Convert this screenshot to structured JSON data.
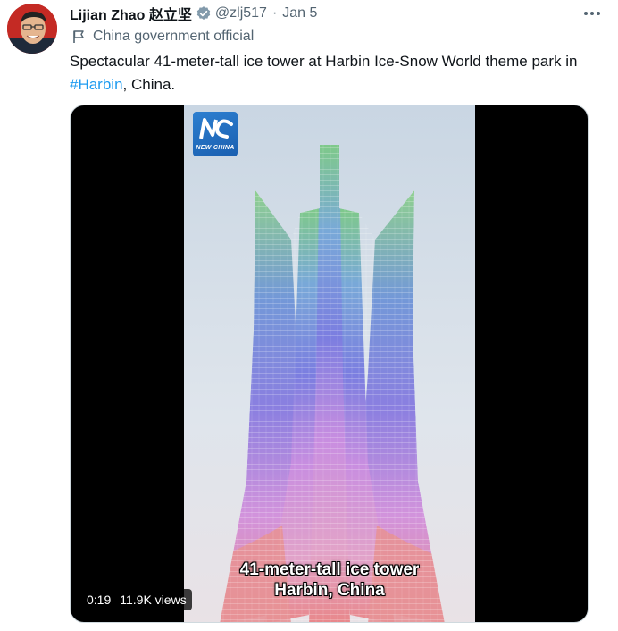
{
  "author": {
    "name": "Lijian Zhao 赵立坚",
    "handle": "@zlj517",
    "separator": "·",
    "date": "Jan 5",
    "label": "China government official",
    "avatar_icon": "avatar-photo",
    "verified_icon": "verified-badge-icon",
    "label_icon": "flag-icon"
  },
  "tweet": {
    "text_before": "Spectacular 41-meter-tall ice tower at Harbin Ice-Snow World theme park in ",
    "hashtag": "#Harbin",
    "text_after": ", China."
  },
  "video": {
    "logo_text": "NEW CHINA",
    "caption_line1": "41-meter-tall ice tower",
    "caption_line2": "Harbin, China",
    "duration": "0:19",
    "views": "11.9K views"
  },
  "colors": {
    "accent": "#1d9bf0",
    "secondary_text": "#536471",
    "verified": "#829aab"
  }
}
